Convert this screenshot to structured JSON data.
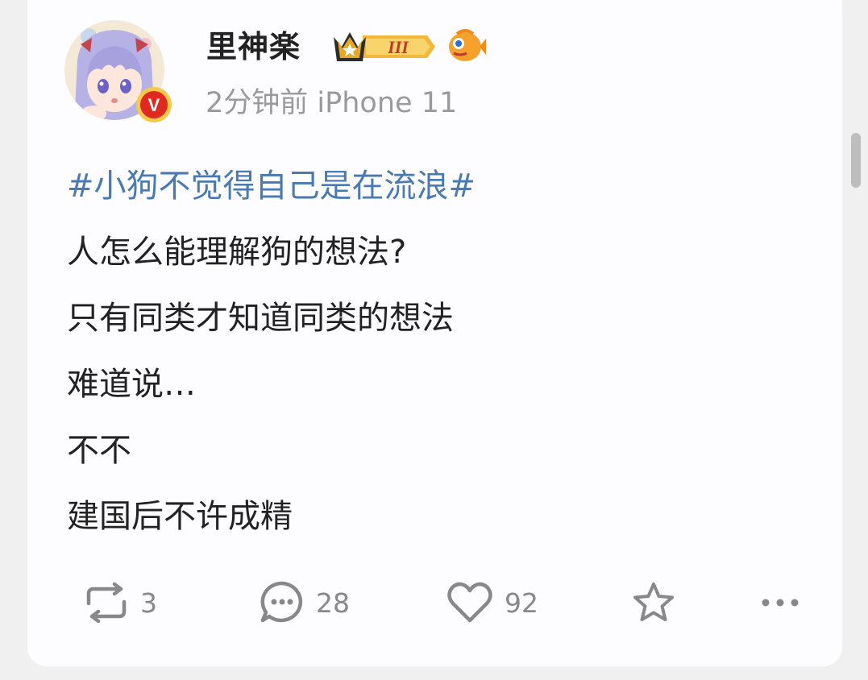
{
  "post": {
    "author": "里神楽",
    "vip_level": "III",
    "time": "2分钟前",
    "device": "iPhone 11",
    "verified_badge": "V",
    "topic": "#小狗不觉得自己是在流浪#",
    "lines": [
      "人怎么能理解狗的想法?",
      "只有同类才知道同类的想法",
      "难道说…",
      "不不",
      "建国后不许成精"
    ]
  },
  "actions": {
    "repost_count": "3",
    "comment_count": "28",
    "like_count": "92"
  },
  "icons": {
    "crown": "crown-icon",
    "fish": "fish-icon",
    "repost": "repost-icon",
    "comment": "comment-icon",
    "like": "heart-icon",
    "favorite": "star-icon",
    "more": "more-icon"
  },
  "colors": {
    "topic": "#4a7ab3",
    "text": "#222222",
    "meta": "#9a9a9a",
    "badge": "#e8a317",
    "verified": "#e02a1f"
  }
}
